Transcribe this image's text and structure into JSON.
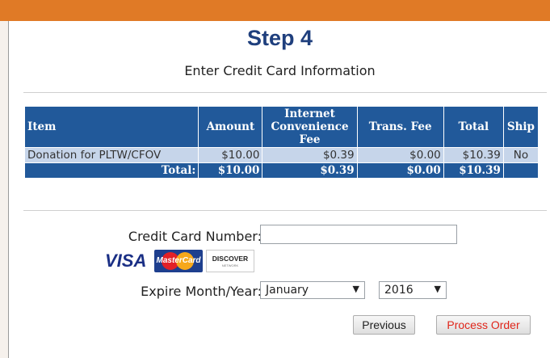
{
  "step": {
    "title": "Step 4",
    "subtitle": "Enter Credit Card Information"
  },
  "table": {
    "headers": {
      "item": "Item",
      "amount": "Amount",
      "fee_line1": "Internet",
      "fee_line2": "Convenience",
      "fee_line3": "Fee",
      "trans_fee": "Trans. Fee",
      "total": "Total",
      "ship": "Ship"
    },
    "row": {
      "item": "Donation for PLTW/CFOV",
      "amount": "$10.00",
      "fee": "$0.39",
      "trans_fee": "$0.00",
      "total": "$10.39",
      "ship": "No"
    },
    "totals": {
      "label": "Total:",
      "amount": "$10.00",
      "fee": "$0.39",
      "trans_fee": "$0.00",
      "total": "$10.39"
    }
  },
  "form": {
    "cc_label": "Credit Card Number:",
    "cc_value": "",
    "expire_label": "Expire Month/Year:",
    "month": "January",
    "year": "2016"
  },
  "cards": {
    "visa": "VISA",
    "mastercard": "MasterCard",
    "discover": "DISCOVER",
    "discover_sub": "NETWORK"
  },
  "buttons": {
    "previous": "Previous",
    "process": "Process Order"
  },
  "colors": {
    "accent": "#e07a26",
    "title": "#1f3f7d",
    "table_header": "#21599a",
    "row_bg": "#c6d5ea",
    "process_text": "#e0261b"
  }
}
